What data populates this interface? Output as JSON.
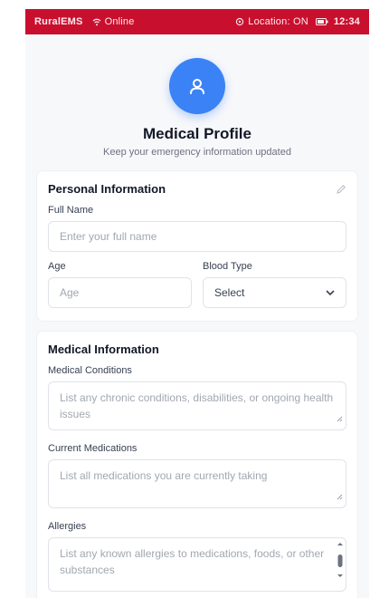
{
  "status_bar": {
    "app_name": "RuralEMS",
    "network": "Online",
    "location": "Location: ON",
    "time": "12:34",
    "accent": "#c8102e"
  },
  "header": {
    "icon": "user-icon",
    "title": "Medical Profile",
    "subtitle": "Keep your emergency information updated"
  },
  "personal": {
    "title": "Personal Information",
    "full_name_label": "Full Name",
    "full_name_placeholder": "Enter your full name",
    "age_label": "Age",
    "age_placeholder": "Age",
    "blood_label": "Blood Type",
    "blood_value": "Select"
  },
  "medical": {
    "title": "Medical Information",
    "conditions_label": "Medical Conditions",
    "conditions_placeholder": "List any chronic conditions, disabilities, or ongoing health issues",
    "medications_label": "Current Medications",
    "medications_placeholder": "List all medications you are currently taking",
    "allergies_label": "Allergies",
    "allergies_placeholder": "List any known allergies to medications, foods, or other substances"
  }
}
